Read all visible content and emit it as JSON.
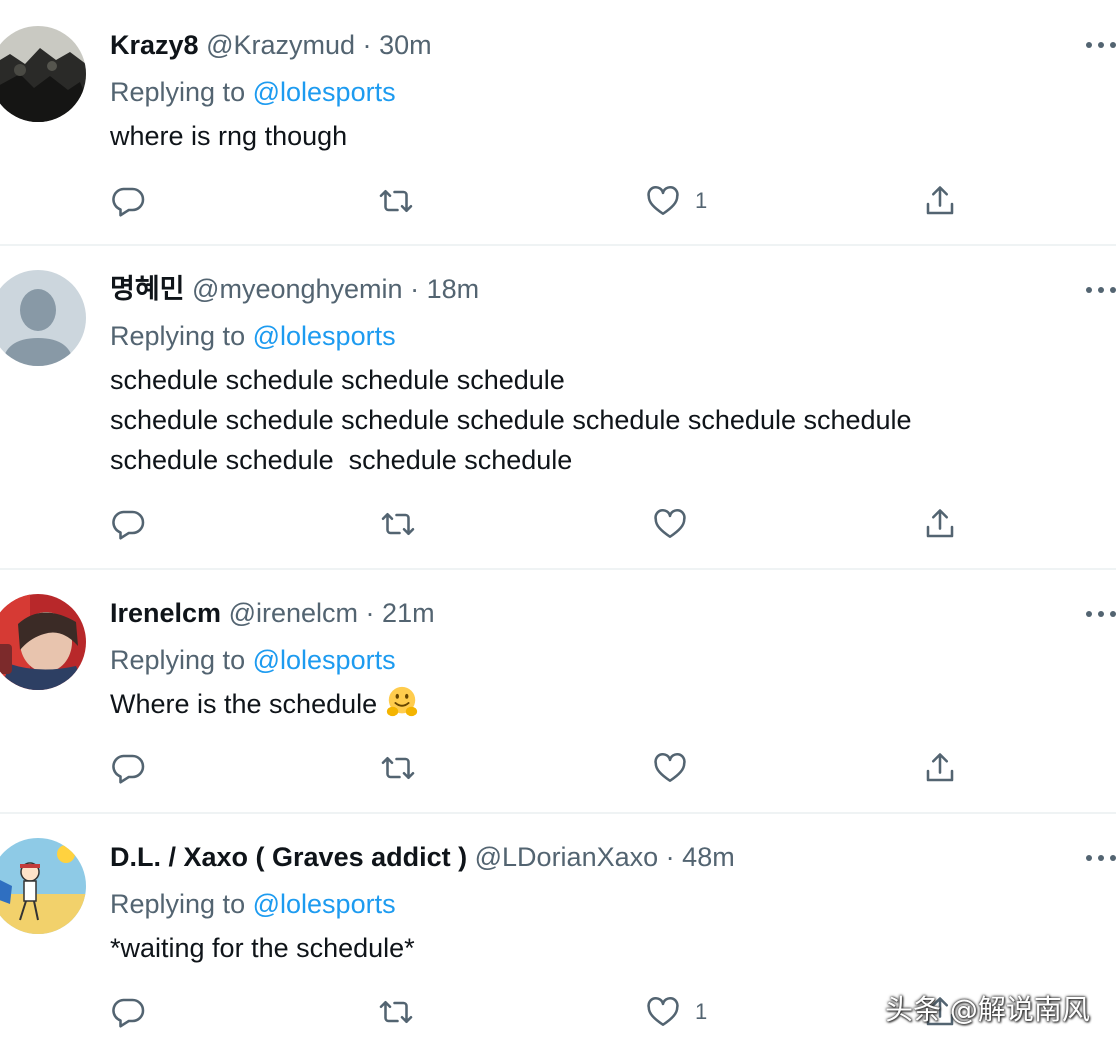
{
  "tweets": [
    {
      "name": "Krazy8",
      "handle": "@Krazymud",
      "dot": "·",
      "time": "30m",
      "reply_prefix": "Replying to",
      "reply_mention": "@lolesports",
      "text": "where is rng though",
      "like_count": "1",
      "avatar": "dark-photo-avatar"
    },
    {
      "name": "명혜민",
      "handle": "@myeonghyemin",
      "dot": "·",
      "time": "18m",
      "reply_prefix": "Replying to",
      "reply_mention": "@lolesports",
      "text": "schedule schedule schedule schedule\nschedule schedule schedule schedule schedule schedule schedule\nschedule schedule  schedule schedule",
      "like_count": "",
      "avatar": "default-person-avatar"
    },
    {
      "name": "Irenelcm",
      "handle": "@irenelcm",
      "dot": "·",
      "time": "21m",
      "reply_prefix": "Replying to",
      "reply_mention": "@lolesports",
      "text": "Where is the schedule",
      "emoji": "hugging-face-emoji",
      "like_count": "",
      "avatar": "photo-avatar-red"
    },
    {
      "name": "D.L. / Xaxo ( Graves addict )",
      "handle": "@LDorianXaxo",
      "dot": "·",
      "time": "48m",
      "reply_prefix": "Replying to",
      "reply_mention": "@lolesports",
      "text": "*waiting for the schedule*",
      "like_count": "1",
      "avatar": "cartoon-beach-avatar"
    }
  ],
  "icons": {
    "reply": "reply-icon",
    "retweet": "retweet-icon",
    "like": "like-icon",
    "share": "share-icon",
    "more": "more-icon"
  },
  "colors": {
    "text": "#0f1419",
    "secondary": "#536471",
    "link": "#1d9bf0",
    "divider": "#eff3f4"
  },
  "watermark": "头条 @解说南风"
}
